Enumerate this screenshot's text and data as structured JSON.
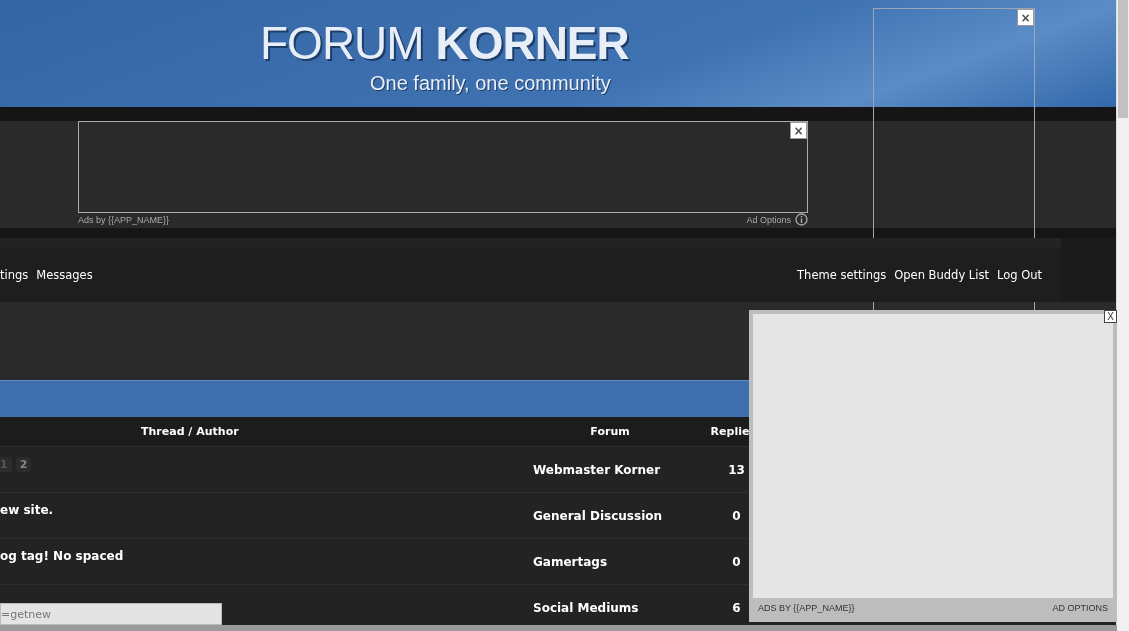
{
  "header": {
    "title_light": "FORUM",
    "title_bold": "KORNER",
    "tagline": "One family, one community"
  },
  "top_ad": {
    "ads_by": "Ads by {{APP_NAME}}",
    "options": "Ad Options",
    "close": "×"
  },
  "side_ad": {
    "close": "×"
  },
  "nav": {
    "left": [
      "tings",
      "Messages"
    ],
    "right": [
      "Theme settings",
      "Open Buddy List",
      "Log Out"
    ]
  },
  "table": {
    "columns": [
      "Thread / Author",
      "Forum",
      "Replie"
    ],
    "rows": [
      {
        "thread": "",
        "pages": [
          {
            "label": "1",
            "selected": true
          },
          {
            "label": "2",
            "selected": false
          }
        ],
        "forum": "Webmaster Korner",
        "replies": "13"
      },
      {
        "thread": "ew site.",
        "forum": "General Discussion",
        "replies": "0"
      },
      {
        "thread": "og tag! No spaced",
        "forum": "Gamertags",
        "replies": "0"
      },
      {
        "thread": "",
        "forum": "Social Mediums",
        "replies": "6"
      }
    ]
  },
  "popup_ad": {
    "close": "X",
    "ads_by": "ADS BY {{APP_NAME}}",
    "options": "AD OPTIONS"
  },
  "status_url": "=getnew"
}
